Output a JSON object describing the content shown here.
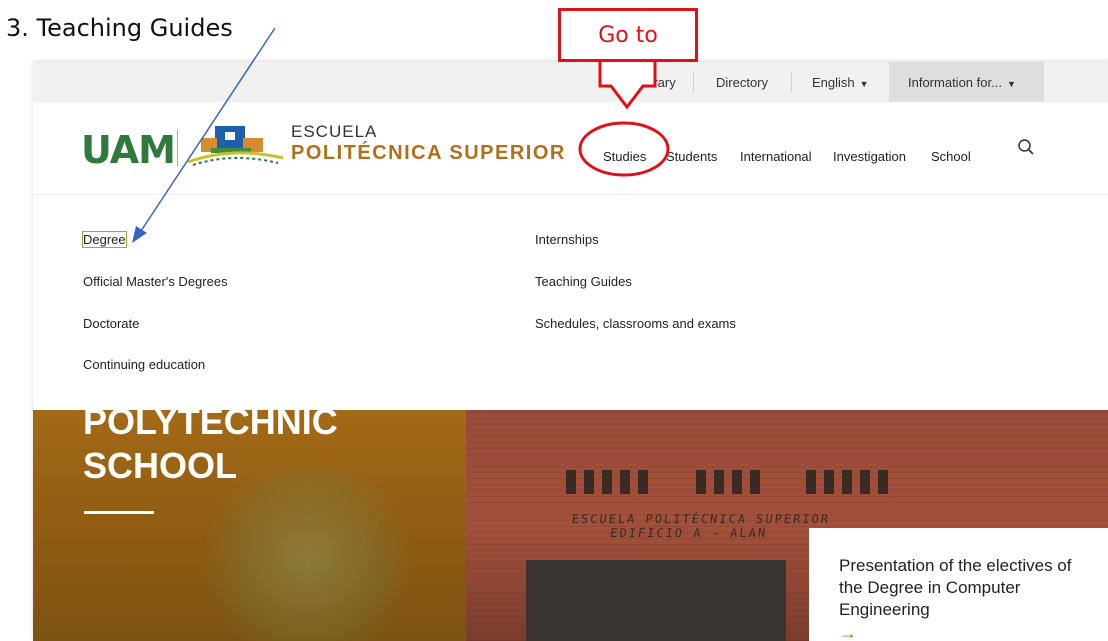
{
  "annotation": {
    "heading": "3.  Teaching Guides",
    "callout": "Go to"
  },
  "topbar": {
    "library": "Library",
    "directory": "Directory",
    "english": "English",
    "info": "Information for..."
  },
  "logo": {
    "uam": "UAM",
    "escuela": "ESCUELA",
    "politecnica": "POLITÉCNICA SUPERIOR"
  },
  "nav": {
    "studies": "Studies",
    "students": "Students",
    "international": "International",
    "investigation": "Investigation",
    "school": "School"
  },
  "menu": {
    "left": [
      "Degree",
      "Official Master's Degrees",
      "Doctorate",
      "Continuing education"
    ],
    "right": [
      "Internships",
      "Teaching Guides",
      "Schedules, classrooms and exams"
    ]
  },
  "hero": {
    "title_line1": "POLYTECHNIC",
    "title_line2": "SCHOOL",
    "sign_line1": "ESCUELA  POLITÉCNICA  SUPERIOR",
    "sign_line2": "EDIFICIO A - ALAN"
  },
  "news": {
    "text": "Presentation of the electives of the Degree in Computer Engineering",
    "arrow": "→"
  },
  "colors": {
    "accent": "#b26f1a",
    "uam_green": "#2f7a3b",
    "annotation_red": "#e0101a",
    "annotation_blue": "#3a63c7"
  }
}
